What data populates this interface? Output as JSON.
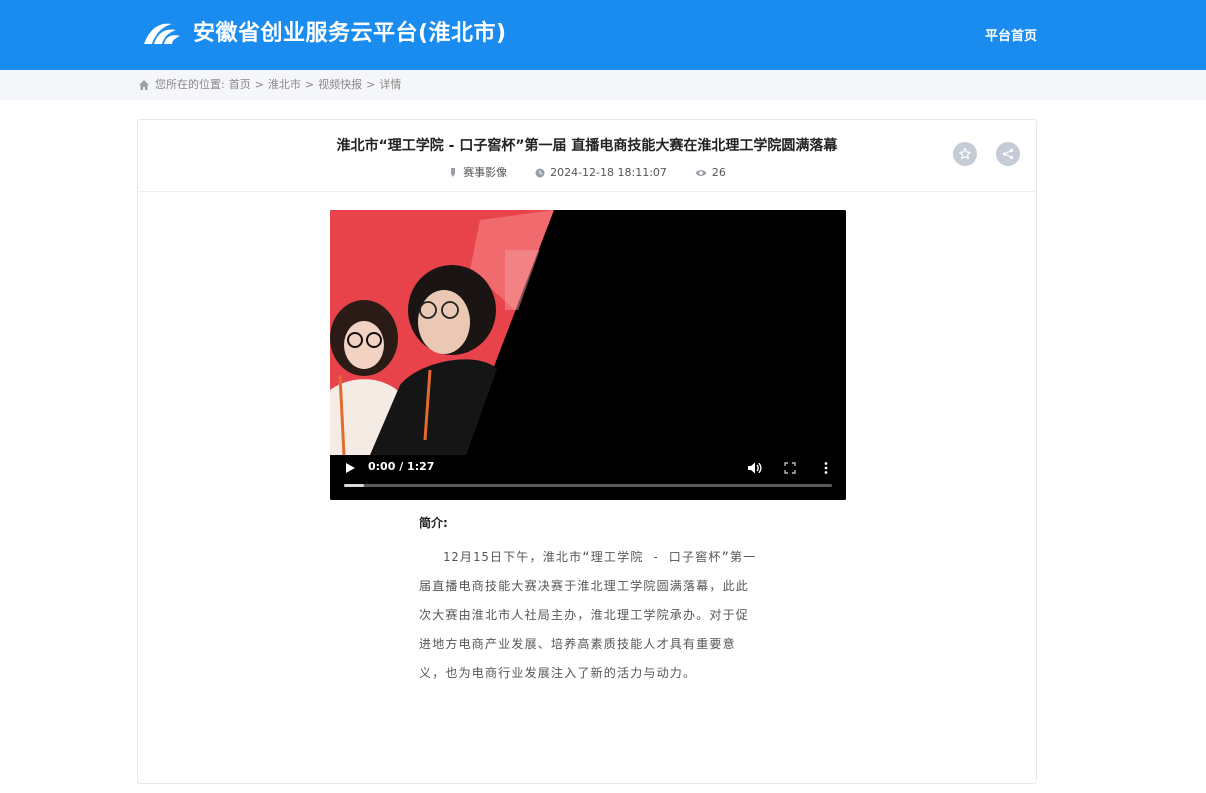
{
  "header": {
    "site_title": "安徽省创业服务云平台(淮北市)",
    "nav_home": "平台首页",
    "logo_icon": "wave-logo-icon",
    "bg_color": "#1a8cf0"
  },
  "breadcrumb": {
    "prefix": "您所在的位置:",
    "items": [
      "首页",
      "淮北市",
      "视频快报",
      "详情"
    ],
    "separator": ">"
  },
  "article": {
    "title": "淮北市“理工学院 - 口子窖杯”第一届 直播电商技能大赛在淮北理工学院圆满落幕",
    "category": "赛事影像",
    "datetime": "2024-12-18 18:11:07",
    "views": "26"
  },
  "video": {
    "time": "0:00 / 1:27",
    "progress": 0.04
  },
  "intro": {
    "label": "简介:",
    "text": "12月15日下午，淮北市“理工学院 - 口子窖杯”第一届直播电商技能大赛决赛于淮北理工学院圆满落幕，此此次大赛由淮北市人社局主办，淮北理工学院承办。对于促进地方电商产业发展、培养高素质技能人才具有重要意义，也为电商行业发展注入了新的活力与动力。"
  }
}
